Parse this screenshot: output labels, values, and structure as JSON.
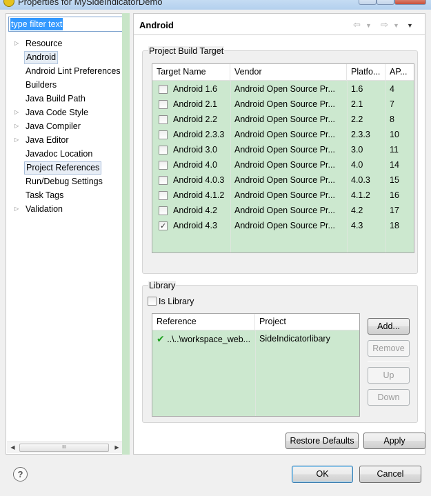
{
  "window": {
    "title": "Properties for MySideIndicatorDemo"
  },
  "filter": {
    "value": "type filter text"
  },
  "tree": {
    "items": [
      {
        "label": "Resource",
        "expandable": true
      },
      {
        "label": "Android",
        "expandable": false
      },
      {
        "label": "Android Lint Preferences",
        "expandable": false
      },
      {
        "label": "Builders",
        "expandable": false
      },
      {
        "label": "Java Build Path",
        "expandable": false
      },
      {
        "label": "Java Code Style",
        "expandable": true
      },
      {
        "label": "Java Compiler",
        "expandable": true
      },
      {
        "label": "Java Editor",
        "expandable": true
      },
      {
        "label": "Javadoc Location",
        "expandable": false
      },
      {
        "label": "Project References",
        "expandable": false
      },
      {
        "label": "Run/Debug Settings",
        "expandable": false
      },
      {
        "label": "Task Tags",
        "expandable": false
      },
      {
        "label": "Validation",
        "expandable": true
      }
    ],
    "scrollbar_thumb": "III"
  },
  "page": {
    "title": "Android"
  },
  "build_target": {
    "group_label": "Project Build Target",
    "headers": [
      "Target Name",
      "Vendor",
      "Platfo...",
      "AP..."
    ],
    "rows": [
      {
        "name": "Android 1.6",
        "vendor": "Android Open Source Pr...",
        "platform": "1.6",
        "api": "4",
        "checked": false
      },
      {
        "name": "Android 2.1",
        "vendor": "Android Open Source Pr...",
        "platform": "2.1",
        "api": "7",
        "checked": false
      },
      {
        "name": "Android 2.2",
        "vendor": "Android Open Source Pr...",
        "platform": "2.2",
        "api": "8",
        "checked": false
      },
      {
        "name": "Android 2.3.3",
        "vendor": "Android Open Source Pr...",
        "platform": "2.3.3",
        "api": "10",
        "checked": false
      },
      {
        "name": "Android 3.0",
        "vendor": "Android Open Source Pr...",
        "platform": "3.0",
        "api": "11",
        "checked": false
      },
      {
        "name": "Android 4.0",
        "vendor": "Android Open Source Pr...",
        "platform": "4.0",
        "api": "14",
        "checked": false
      },
      {
        "name": "Android 4.0.3",
        "vendor": "Android Open Source Pr...",
        "platform": "4.0.3",
        "api": "15",
        "checked": false
      },
      {
        "name": "Android 4.1.2",
        "vendor": "Android Open Source Pr...",
        "platform": "4.1.2",
        "api": "16",
        "checked": false
      },
      {
        "name": "Android 4.2",
        "vendor": "Android Open Source Pr...",
        "platform": "4.2",
        "api": "17",
        "checked": false
      },
      {
        "name": "Android 4.3",
        "vendor": "Android Open Source Pr...",
        "platform": "4.3",
        "api": "18",
        "checked": true
      }
    ]
  },
  "library": {
    "group_label": "Library",
    "is_library_label": "Is Library",
    "is_library_checked": false,
    "headers": [
      "Reference",
      "Project"
    ],
    "rows": [
      {
        "reference": "..\\..\\workspace_web...",
        "project": "SideIndicatorlibary",
        "status_icon": "check-icon"
      }
    ],
    "buttons": {
      "add": "Add...",
      "remove": "Remove",
      "up": "Up",
      "down": "Down"
    }
  },
  "actions": {
    "restore_defaults": "Restore Defaults",
    "apply": "Apply"
  },
  "dialog": {
    "ok": "OK",
    "cancel": "Cancel",
    "help_glyph": "?"
  },
  "colors": {
    "table_bg": "#cce8cf",
    "selection": "#3399ff"
  }
}
